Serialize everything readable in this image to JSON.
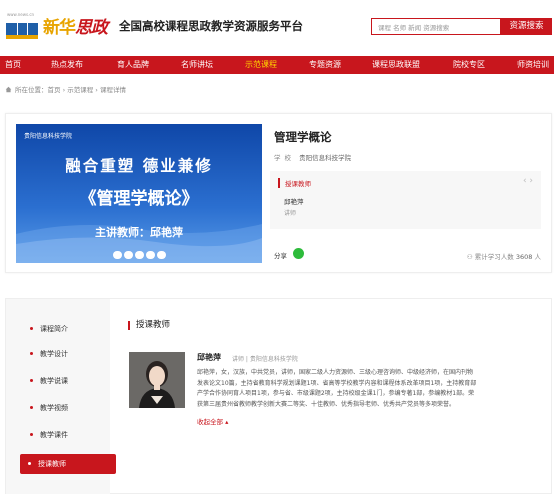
{
  "header": {
    "logo_small": "www.news.cn",
    "logo_brand_a": "新华",
    "logo_brand_b": "思政",
    "site_title": "全国高校课程思政教学资源服务平台",
    "search_placeholder": "课程 名师 新闻 资源搜索",
    "search_button": "资源搜索"
  },
  "nav": [
    {
      "label": "首页"
    },
    {
      "label": "热点发布"
    },
    {
      "label": "育人品牌"
    },
    {
      "label": "名师讲坛"
    },
    {
      "label": "示范课程"
    },
    {
      "label": "专题资源"
    },
    {
      "label": "课程思政联盟"
    },
    {
      "label": "院校专区"
    },
    {
      "label": "师资培训"
    }
  ],
  "breadcrumb": "所在位置：首页 › 示范课程 › 课程详情",
  "course": {
    "cover": {
      "logo": "贵阳信息科技学院",
      "line1": "融合重塑  德业兼修",
      "line2": "《管理学概论》",
      "line3": "主讲教师：邱艳萍"
    },
    "title": "管理学概论",
    "school_label": "学校",
    "school_name": "贵阳信息科技学院",
    "teacher_panel_title": "授课教师",
    "teacher_name": "邱艳萍",
    "teacher_role": "讲师",
    "arrows": "‹  ›",
    "share_label": "分享",
    "learners_label": "累计学习人数",
    "learners_count": "3608",
    "learners_unit": "人"
  },
  "sidebar": [
    {
      "label": "课程简介"
    },
    {
      "label": "教学设计"
    },
    {
      "label": "教学说课"
    },
    {
      "label": "教学视频"
    },
    {
      "label": "教学课件"
    },
    {
      "label": "授课教师"
    }
  ],
  "teacher_section": {
    "title": "授课教师",
    "name": "邱艳萍",
    "meta": "讲师  |  贵阳信息科技学院",
    "bio_lines": [
      "邱艳萍，女，汉族，中共党员，讲师，国家二级人力资源师、三级心理咨询师、中级经济师，在国内刊物",
      "发表论文10篇，主持省教育科学规划课题1项、省高等学校教学内容和课程体系改革项目1项，主持教育部",
      "产学合作协同育人项目1项，参与省、市级课题2项，主持校级金课1门，参编专著1部，参编教材1部。荣",
      "获第三届贵州省教师教学创新大赛二等奖、十佳教师、优秀指导老师、优秀共产党员等多项荣誉。"
    ],
    "collapse": "收起全部 ▴"
  }
}
